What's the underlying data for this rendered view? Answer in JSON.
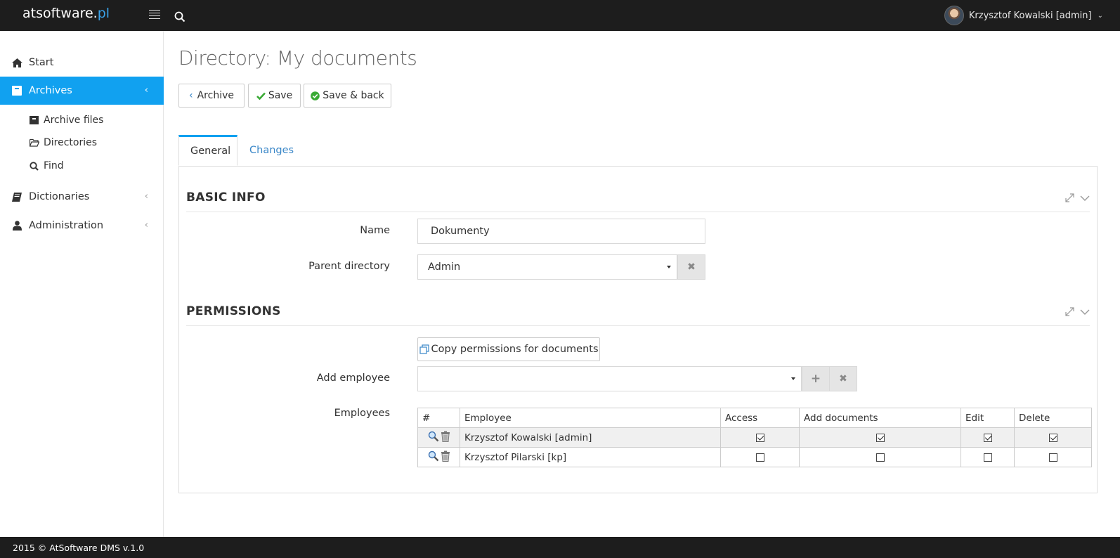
{
  "header": {
    "brand_main": "atsoftware.",
    "brand_tld": "pl",
    "user_name": "Krzysztof Kowalski [admin]"
  },
  "sidebar": {
    "items": [
      {
        "label": "Start",
        "icon": "home-icon"
      },
      {
        "label": "Archives",
        "icon": "archive-icon",
        "active": true
      },
      {
        "label": "Dictionaries",
        "icon": "book-icon"
      },
      {
        "label": "Administration",
        "icon": "user-icon"
      }
    ],
    "sub_items": [
      {
        "label": "Archive files",
        "icon": "archive-box-icon"
      },
      {
        "label": "Directories",
        "icon": "folder-open-icon"
      },
      {
        "label": "Find",
        "icon": "search-icon"
      }
    ]
  },
  "page": {
    "title": "Directory: My documents"
  },
  "toolbar": {
    "archive_label": "Archive",
    "save_label": "Save",
    "save_back_label": "Save & back"
  },
  "tabs": [
    {
      "label": "General",
      "active": true
    },
    {
      "label": "Changes",
      "active": false
    }
  ],
  "basic_info": {
    "title": "BASIC INFO",
    "name_label": "Name",
    "name_value": "Dokumenty",
    "parent_label": "Parent directory",
    "parent_value": "Admin"
  },
  "permissions": {
    "title": "PERMISSIONS",
    "copy_label": "Copy permissions for documents",
    "add_employee_label": "Add employee",
    "add_employee_value": "",
    "employees_label": "Employees",
    "columns": [
      "#",
      "Employee",
      "Access",
      "Add documents",
      "Edit",
      "Delete"
    ],
    "rows": [
      {
        "employee": "Krzysztof Kowalski [admin]",
        "access": true,
        "add_documents": true,
        "edit": true,
        "delete": true
      },
      {
        "employee": "Krzysztof Pilarski [kp]",
        "access": false,
        "add_documents": false,
        "edit": false,
        "delete": false
      }
    ]
  },
  "footer": {
    "text": "2015 © AtSoftware DMS v.1.0"
  },
  "colors": {
    "accent": "#11a1f0",
    "topbar": "#1d1d1d",
    "link": "#3a87c8",
    "success": "#3aaa35"
  }
}
